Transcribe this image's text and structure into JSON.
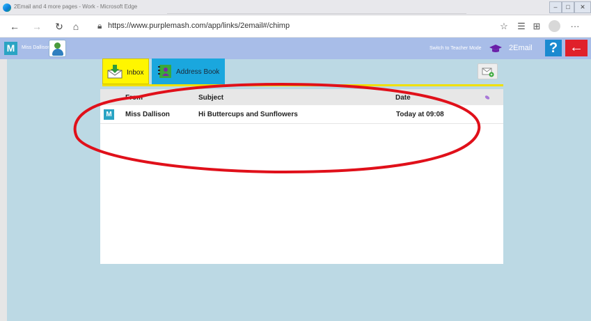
{
  "window": {
    "title": "2Email and 4 more pages - Work - Microsoft Edge",
    "controls": {
      "minimize": "–",
      "maximize": "□",
      "close": "✕"
    }
  },
  "browser": {
    "url": "https://www.purplemash.com/app/links/2email#/chimp",
    "icons": [
      "back-arrow-icon",
      "forward-arrow-icon",
      "refresh-icon",
      "home-icon",
      "lock-icon",
      "favorite-star-icon",
      "favorites-icon",
      "collections-icon",
      "profile-icon",
      "more-icon"
    ]
  },
  "header": {
    "logo": "M",
    "user_name": "Miss Dallison",
    "teacher_mode": "Switch to Teacher Mode",
    "app_name": "2Email",
    "help": "?",
    "back": "←"
  },
  "tabs": {
    "inbox": "Inbox",
    "address_book": "Address Book"
  },
  "list": {
    "columns": {
      "from": "From",
      "subject": "Subject",
      "date": "Date"
    },
    "messages": [
      {
        "avatar": "M",
        "from": "Miss Dallison",
        "subject": "Hi Buttercups and Sunflowers",
        "date": "Today at 09:08"
      }
    ]
  },
  "colors": {
    "header_bg": "#a8bde8",
    "app_bg": "#bcd9e4",
    "inbox_tab": "#fff600",
    "address_tab": "#1aa7de",
    "annotation": "#e0101a"
  }
}
